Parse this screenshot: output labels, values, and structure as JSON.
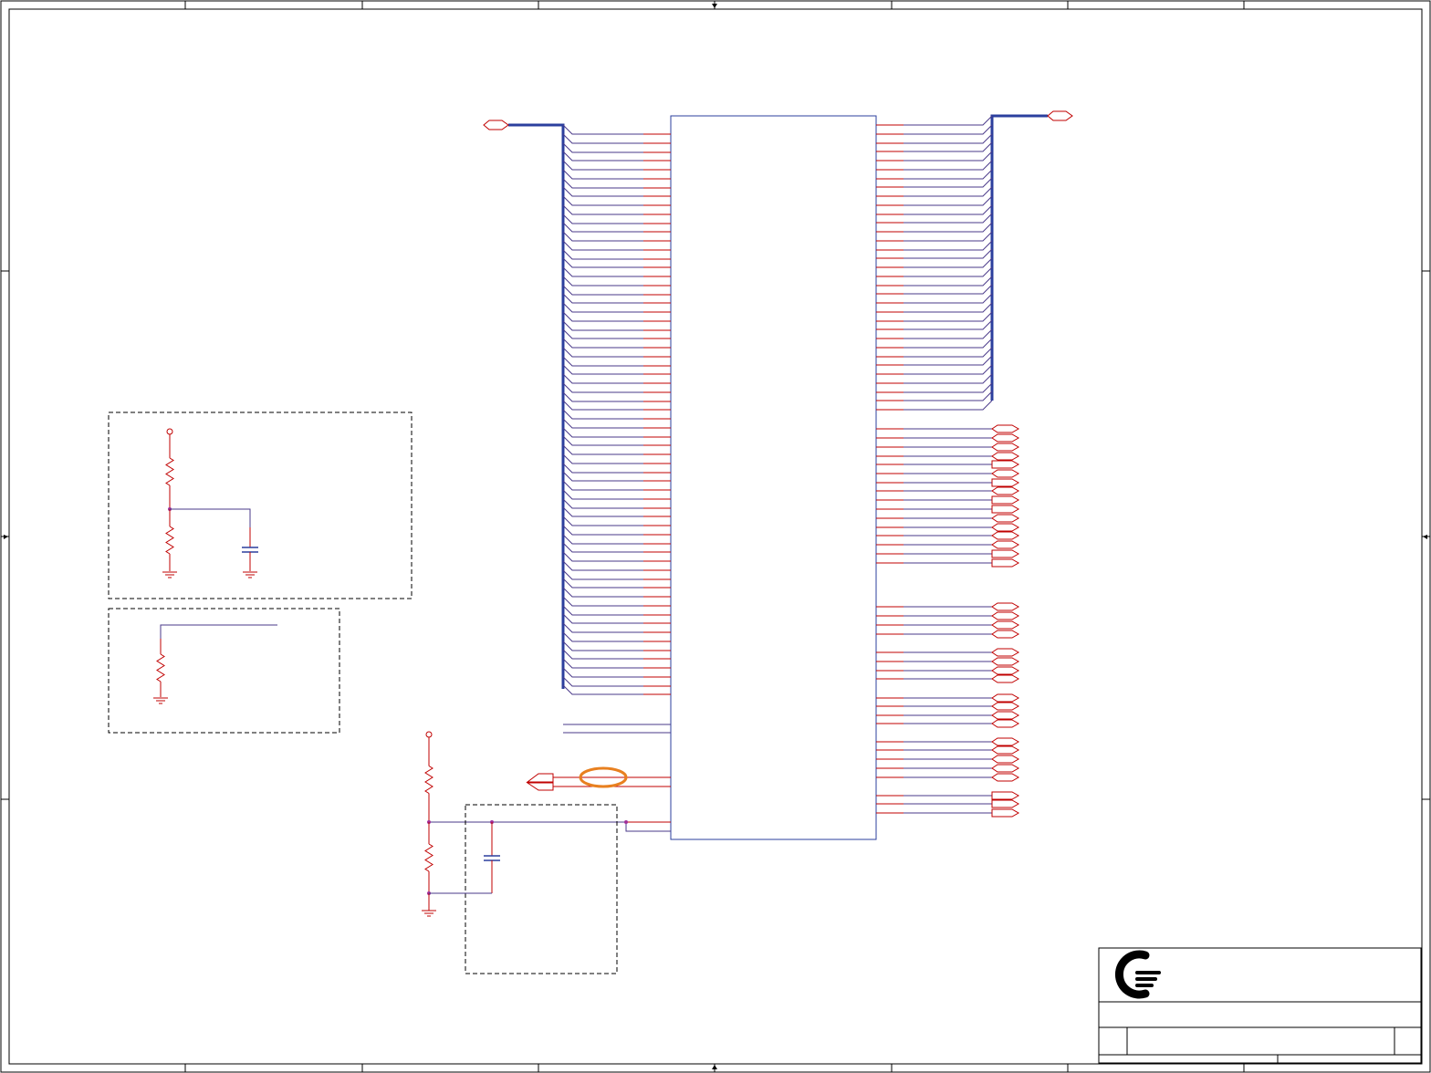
{
  "sheet": {
    "title_block": {
      "logo": "company-logo",
      "title": "",
      "revision": ""
    }
  },
  "colors": {
    "border": "#000000",
    "wire": "#c00000",
    "net": "#4a3a8a",
    "bus": "#2b3f9e",
    "component": "#c00000",
    "capacitor": "#2b3f9e",
    "junction": "#a0309a",
    "highlight": "#e88020",
    "ic_outline": "#2b3f9e",
    "dashed_box": "#000000"
  },
  "icons": [
    "company-logo",
    "ground-icon",
    "power-pin-icon",
    "resistor-icon",
    "capacitor-icon",
    "bus-port-icon",
    "off-page-connector-icon"
  ]
}
